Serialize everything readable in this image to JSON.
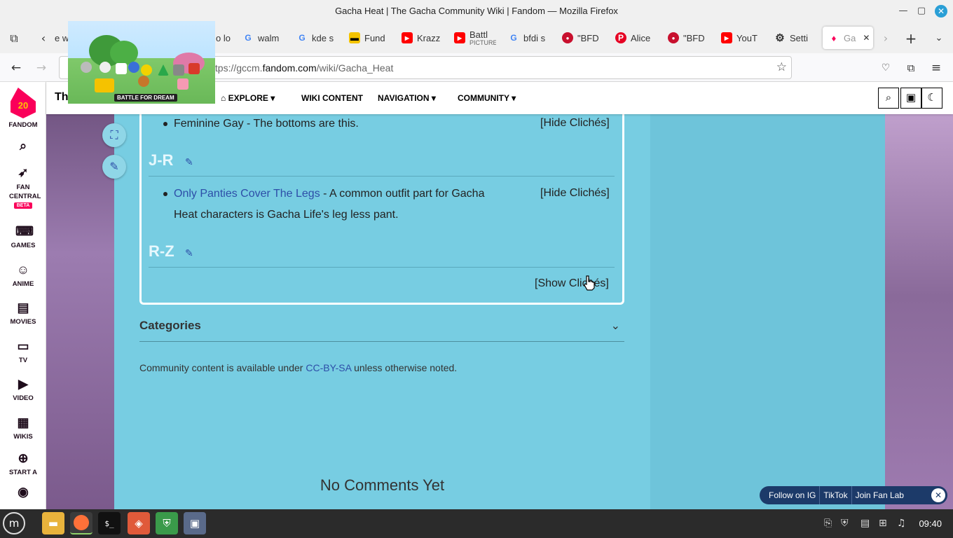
{
  "window": {
    "title": "Gacha Heat | The Gacha Community Wiki | Fandom — Mozilla Firefox"
  },
  "tabs": [
    {
      "label": "e w",
      "icon": "tab-icon"
    },
    {
      "label": "o lo",
      "icon": "tab-icon"
    },
    {
      "label": "walm",
      "icon": "google-icon"
    },
    {
      "label": "kde s",
      "icon": "google-icon"
    },
    {
      "label": "Fund",
      "icon": "fund-icon"
    },
    {
      "label": "Krazz",
      "icon": "youtube-icon"
    },
    {
      "label": "Battl",
      "sub": "PICTURE",
      "icon": "youtube-icon"
    },
    {
      "label": "bfdi s",
      "icon": "google-icon"
    },
    {
      "label": "\"BFD",
      "icon": "fandom-icon"
    },
    {
      "label": "Alice",
      "icon": "pinterest-icon"
    },
    {
      "label": "\"BFD",
      "icon": "fandom-icon"
    },
    {
      "label": "YouT",
      "icon": "youtube-icon"
    },
    {
      "label": "Setti",
      "icon": "gear-icon"
    },
    {
      "label": "Ga",
      "icon": "fandom-icon",
      "active": true
    }
  ],
  "navbar": {
    "url_prefix": "ttps://gccm.",
    "url_domain": "fandom.com",
    "url_path": "/wiki/Gacha_Heat"
  },
  "fandom_sidebar": {
    "logo_label": "FANDOM",
    "logo_number": "20",
    "items": [
      {
        "label": "FAN CENTRAL",
        "badge": "BETA"
      },
      {
        "label": "GAMES"
      },
      {
        "label": "ANIME"
      },
      {
        "label": "MOVIES"
      },
      {
        "label": "TV"
      },
      {
        "label": "VIDEO"
      },
      {
        "label": "WIKIS"
      },
      {
        "label": "START A"
      }
    ]
  },
  "wiki_header": {
    "site_title_fragment": "Th",
    "nav": [
      {
        "label": "EXPLORE",
        "dropdown": true
      },
      {
        "label": "WIKI CONTENT",
        "dropdown": false
      },
      {
        "label": "NAVIGATION",
        "dropdown": true
      },
      {
        "label": "COMMUNITY",
        "dropdown": true
      }
    ]
  },
  "video": {
    "logo_text": "BATTLE FOR DREAM"
  },
  "cliches": {
    "item_feminine": "Feminine Gay - The bottoms are this.",
    "hide_1": "[Hide Clichés]",
    "section_jr": "J-R",
    "item_panties_link": "Only Panties Cover The Legs",
    "item_panties_rest_1": " - A common outfit part for Gacha",
    "item_panties_rest_2": "Heat characters is Gacha Life's leg less pant.",
    "hide_2": "[Hide Clichés]",
    "section_rz": "R-Z",
    "show": "[Show Clichés]"
  },
  "categories": {
    "title": "Categories"
  },
  "license": {
    "before": "Community content is available under ",
    "link": "CC-BY-SA",
    "after": " unless otherwise noted."
  },
  "comments": {
    "title": "No Comments Yet"
  },
  "social_bar": {
    "items": [
      "Follow on IG",
      "TikTok",
      "Join Fan Lab"
    ]
  },
  "taskbar": {
    "clock": "09:40"
  },
  "colors": {
    "content_bg": "#77cde2",
    "link": "#2d4ea8",
    "fandom_pink": "#fa005a",
    "social_bg": "#1c3a69"
  }
}
